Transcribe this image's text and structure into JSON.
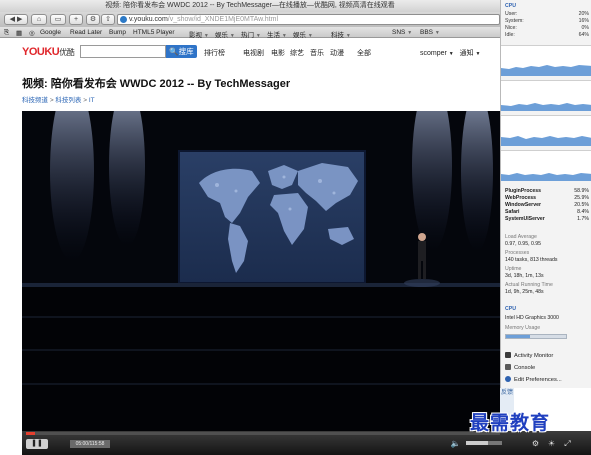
{
  "browser": {
    "window_title": "视频: 陪你看发布会 WWDC 2012 -- By TechMessager—在线播放—优酷网, 视频高清在线观看",
    "url_host": "v.youku.com",
    "url_path": "/v_show/id_XNDE1MjE0MTAw.html",
    "bookmarks": [
      "Google",
      "Read Later",
      "Bump",
      "HTML5 Player",
      "影视",
      "娱乐",
      "热门",
      "生活",
      "娱乐",
      "科技",
      "SNS",
      "BBS"
    ]
  },
  "youku": {
    "logo_text": "YOUKU",
    "logo_cn": "优酷",
    "search_button": "搜库",
    "nav": [
      "排行榜",
      "电视剧",
      "电影",
      "综艺",
      "音乐",
      "动漫",
      "全部"
    ],
    "username": "scomper",
    "notify": "通知"
  },
  "page": {
    "title": "视频: 陪你看发布会 WWDC 2012 -- By TechMessager",
    "breadcrumb": [
      "科技频道",
      "科技列表",
      "IT"
    ]
  },
  "player": {
    "progress": 0.02,
    "volume": 0.6,
    "time": "05:00/115:58"
  },
  "monitor": {
    "title": "CPU",
    "stats": [
      {
        "label": "User:",
        "value": "20%"
      },
      {
        "label": "System:",
        "value": "16%"
      },
      {
        "label": "Nice:",
        "value": "0%"
      },
      {
        "label": "Idle:",
        "value": "64%"
      }
    ],
    "processes": [
      {
        "name": "PluginProcess",
        "value": "58.9%"
      },
      {
        "name": "WebProcess",
        "value": "25.9%"
      },
      {
        "name": "WindowServer",
        "value": "20.5%"
      },
      {
        "name": "Safari",
        "value": "8.4%"
      },
      {
        "name": "SystemUIServer",
        "value": "1.7%"
      }
    ],
    "load_average_label": "Load Average",
    "load_average": "0.97, 0.95, 0.95",
    "processes_label": "Processes",
    "processes_value": "140 tasks, 813 threads",
    "uptime_label": "Uptime",
    "uptime": "3d, 18h, 1m, 13s",
    "actual_running_label": "Actual Running Time",
    "actual_running": "1d, 9h, 25m, 48s",
    "gpu_label": "CPU",
    "gpu": "Intel HD Graphics 3000",
    "memory_label": "Memory Usage",
    "memory_usage": 0.4,
    "menu": [
      "Activity Monitor",
      "Console",
      "Edit Preferences..."
    ]
  },
  "side_tab": "反馈",
  "watermark": "最需教育",
  "colors": {
    "youku_red": "#e0272c",
    "youku_blue": "#1a66c0",
    "link": "#2a65b5",
    "accent": "#2e62b0"
  }
}
